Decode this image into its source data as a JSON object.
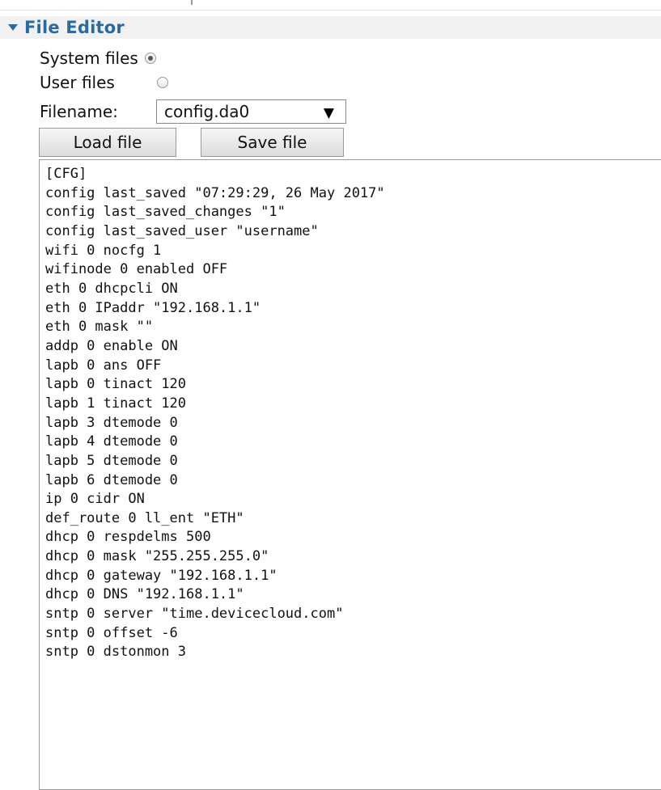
{
  "section": {
    "title": "File Editor"
  },
  "file_type": {
    "options": [
      {
        "label": "System files",
        "selected": true
      },
      {
        "label": "User files",
        "selected": false
      }
    ]
  },
  "filename": {
    "label": "Filename:",
    "value": "config.da0",
    "arrow": "▼"
  },
  "buttons": {
    "load": "Load file",
    "save": "Save file"
  },
  "editor": {
    "content": "[CFG]\nconfig last_saved \"07:29:29, 26 May 2017\"\nconfig last_saved_changes \"1\"\nconfig last_saved_user \"username\"\nwifi 0 nocfg 1\nwifinode 0 enabled OFF\neth 0 dhcpcli ON\neth 0 IPaddr \"192.168.1.1\"\neth 0 mask \"\"\naddp 0 enable ON\nlapb 0 ans OFF\nlapb 0 tinact 120\nlapb 1 tinact 120\nlapb 3 dtemode 0\nlapb 4 dtemode 0\nlapb 5 dtemode 0\nlapb 6 dtemode 0\nip 0 cidr ON\ndef_route 0 ll_ent \"ETH\"\ndhcp 0 respdelms 500\ndhcp 0 mask \"255.255.255.0\"\ndhcp 0 gateway \"192.168.1.1\"\ndhcp 0 DNS \"192.168.1.1\"\nsntp 0 server \"time.devicecloud.com\"\nsntp 0 offset -6\nsntp 0 dstonmon 3"
  },
  "icons": {
    "section_toggle": "caret-down-icon",
    "select_arrow": "dropdown-arrow-icon"
  },
  "colors": {
    "header_text": "#2a6aa0",
    "header_bg": "#f1f1f1"
  }
}
